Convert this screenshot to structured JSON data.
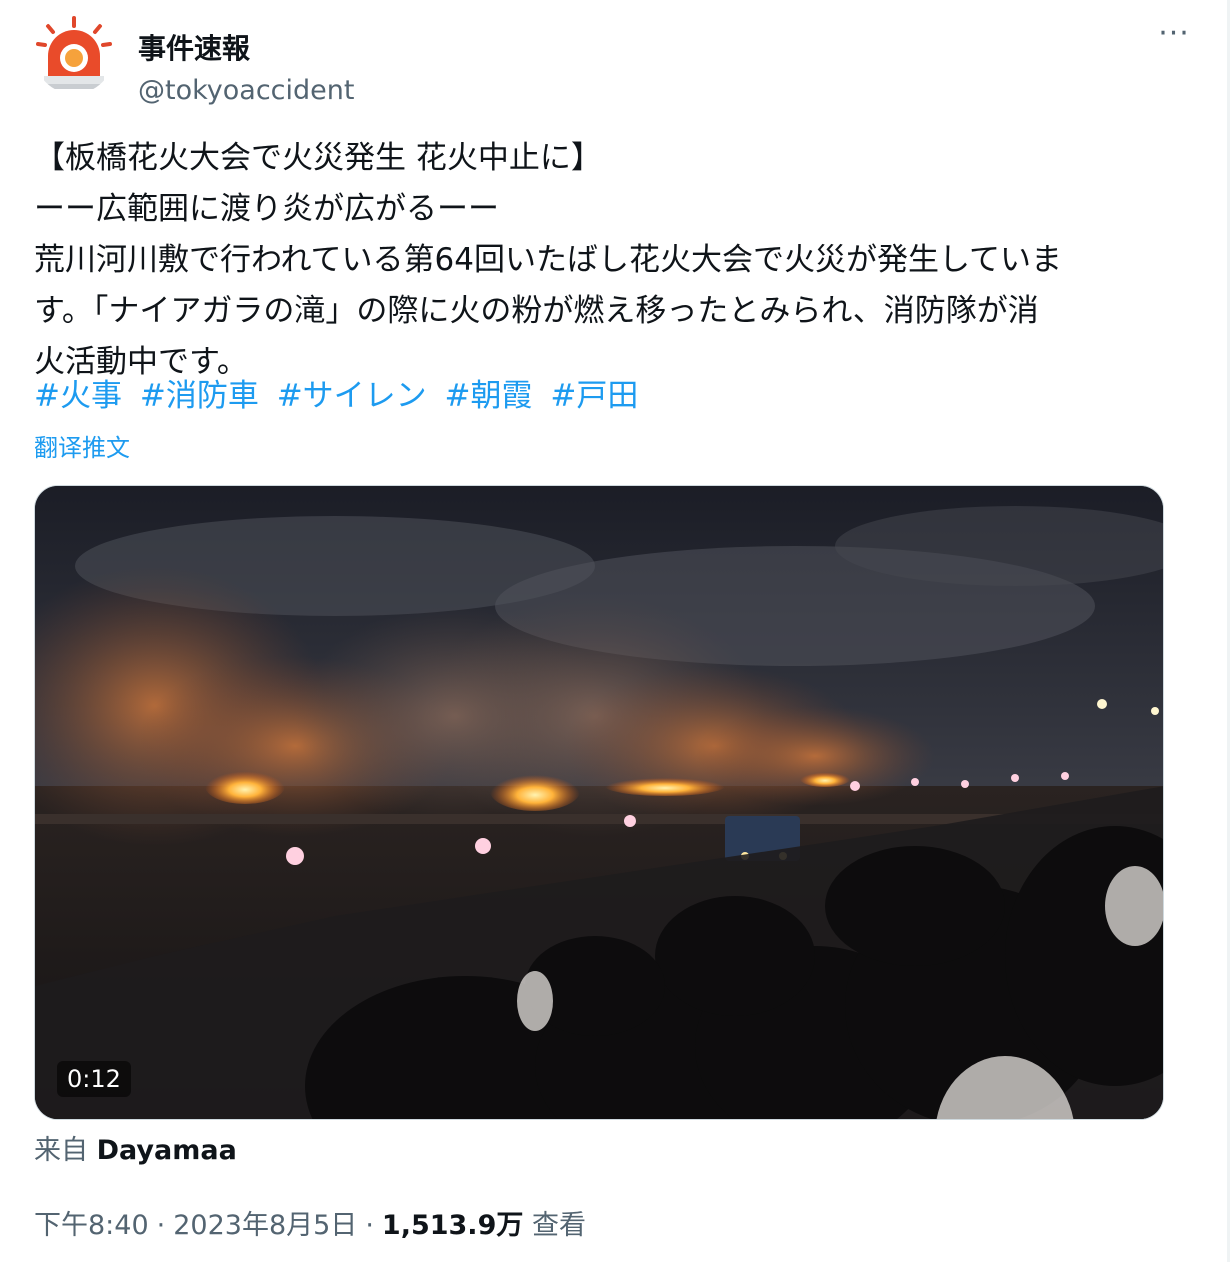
{
  "user": {
    "display_name": "事件速報",
    "handle": "@tokyoaccident",
    "avatar_icon": "siren-icon"
  },
  "more_label": "···",
  "tweet": {
    "lines": [
      "【板橋花火大会で火災発生 花火中止に】",
      "ーー広範囲に渡り炎が広がるーー",
      "荒川河川敷で行われている第64回いたばし花火大会で火災が発生していま",
      "す。「ナイアガラの滝」の際に火の粉が燃え移ったとみられ、消防隊が消",
      "火活動中です。"
    ],
    "hashtags": [
      "#火事",
      "#消防車",
      "#サイレン",
      "#朝霞",
      "#戸田"
    ],
    "translate_label": "翻译推文"
  },
  "media": {
    "duration": "0:12"
  },
  "source": {
    "prefix": "来自",
    "author": "Dayamaa"
  },
  "meta": {
    "time": "下午8:40",
    "date": "2023年8月5日",
    "views_count": "1,513.9万",
    "views_label": "查看"
  },
  "colors": {
    "link": "#1d9bf0",
    "secondary_text": "#536471",
    "primary_text": "#0f1419"
  }
}
